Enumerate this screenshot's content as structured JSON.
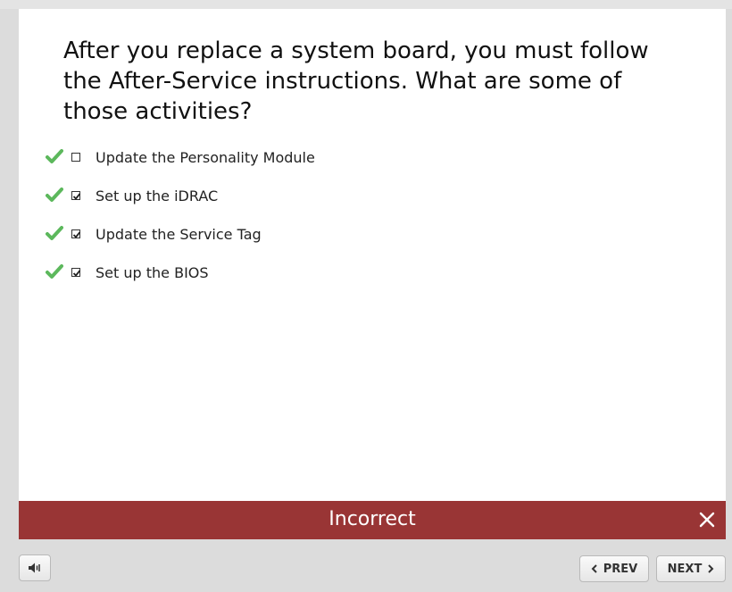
{
  "question": {
    "text": "After you replace a system board, you must follow the After-Service instructions. What are some of those activities?"
  },
  "options": [
    {
      "label": "Update the Personality Module",
      "checked": false,
      "correct_marker": "check-icon"
    },
    {
      "label": "Set up the iDRAC",
      "checked": true,
      "correct_marker": "check-icon"
    },
    {
      "label": "Update the Service Tag",
      "checked": true,
      "correct_marker": "check-icon"
    },
    {
      "label": "Set up the BIOS",
      "checked": true,
      "correct_marker": "check-icon"
    }
  ],
  "feedback": {
    "text": "Incorrect",
    "close_icon": "close-icon",
    "color": "#993535"
  },
  "nav": {
    "audio_icon": "speaker-icon",
    "prev_label": "PREV",
    "next_label": "NEXT"
  },
  "colors": {
    "tick": "#5cb85c",
    "feedback_bg": "#993535",
    "background": "#dcdcdc"
  }
}
